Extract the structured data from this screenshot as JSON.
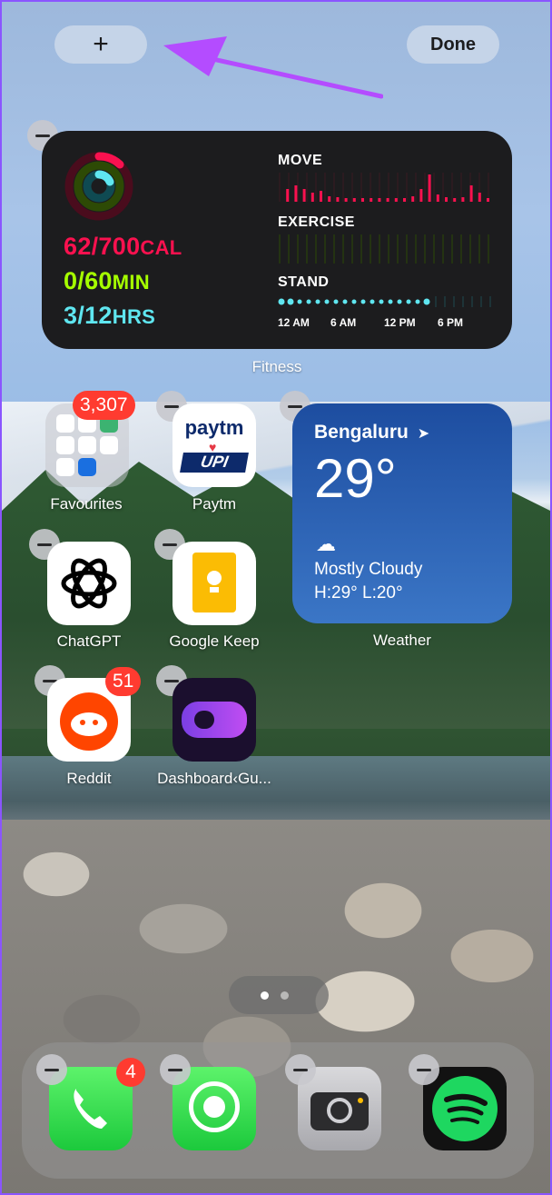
{
  "header": {
    "add_label": "+",
    "done_label": "Done"
  },
  "fitness": {
    "move": "62/700",
    "move_unit": "CAL",
    "exercise": "0/60",
    "exercise_unit": "MIN",
    "stand": "3/12",
    "stand_unit": "HRS",
    "labels": {
      "move": "MOVE",
      "exercise": "EXERCISE",
      "stand": "STAND"
    },
    "times": [
      "12 AM",
      "6 AM",
      "12 PM",
      "6 PM"
    ],
    "caption": "Fitness",
    "colors": {
      "move": "#fa114f",
      "exercise": "#a6ff00",
      "stand": "#5fe6f0"
    }
  },
  "apps": {
    "favourites": {
      "label": "Favourites",
      "badge": "3,307"
    },
    "paytm": {
      "label": "Paytm",
      "logo_top": "paytm",
      "logo_bottom": "UPI"
    },
    "chatgpt": {
      "label": "ChatGPT"
    },
    "keep": {
      "label": "Google Keep"
    },
    "reddit": {
      "label": "Reddit",
      "badge": "51"
    },
    "dashboard": {
      "label": "Dashboard‹Gu..."
    }
  },
  "weather": {
    "city": "Bengaluru",
    "temp": "29°",
    "condition": "Mostly Cloudy",
    "range": "H:29° L:20°",
    "caption": "Weather"
  },
  "dock": {
    "phone": {
      "name": "phone-icon",
      "badge": "4"
    },
    "whatsapp": {
      "name": "whatsapp-icon"
    },
    "camera": {
      "name": "camera-icon"
    },
    "spotify": {
      "name": "spotify-icon"
    }
  }
}
